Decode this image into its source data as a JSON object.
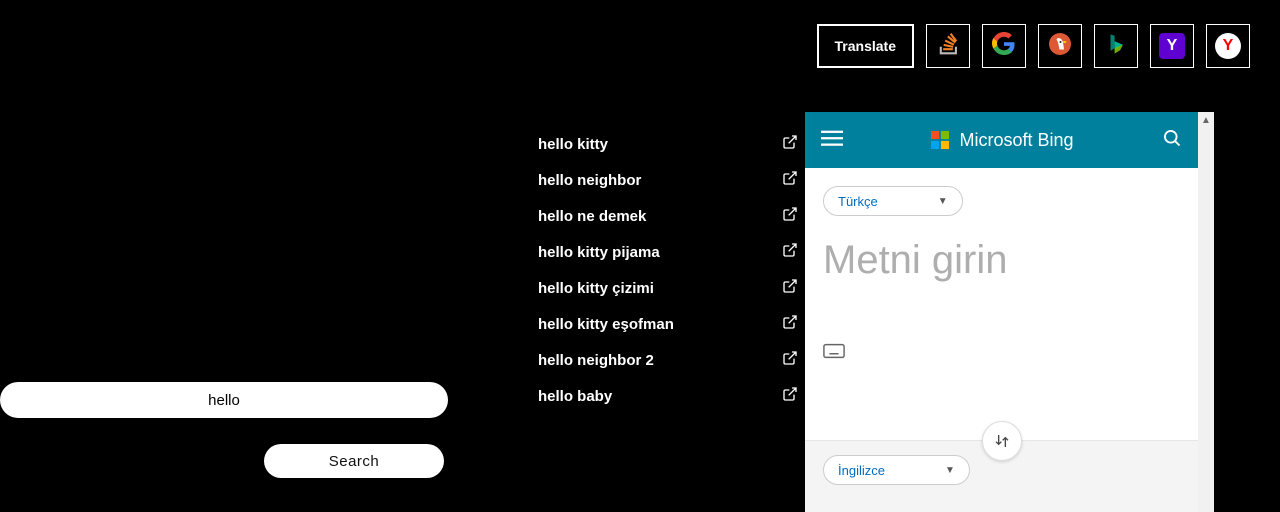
{
  "toolbar": {
    "translate_label": "Translate",
    "items": [
      {
        "name": "stackoverflow"
      },
      {
        "name": "google"
      },
      {
        "name": "duckduckgo"
      },
      {
        "name": "bing"
      },
      {
        "name": "yahoo"
      },
      {
        "name": "yandex"
      }
    ]
  },
  "search": {
    "value": "hello",
    "button_label": "Search"
  },
  "suggestions": [
    "hello kitty",
    "hello neighbor",
    "hello ne demek",
    "hello kitty pijama",
    "hello kitty çizimi",
    "hello kitty eşofman",
    "hello neighbor 2",
    "hello baby"
  ],
  "translator": {
    "brand": "Microsoft Bing",
    "from_lang": "Türkçe",
    "to_lang": "İngilizce",
    "placeholder": "Metni girin"
  }
}
